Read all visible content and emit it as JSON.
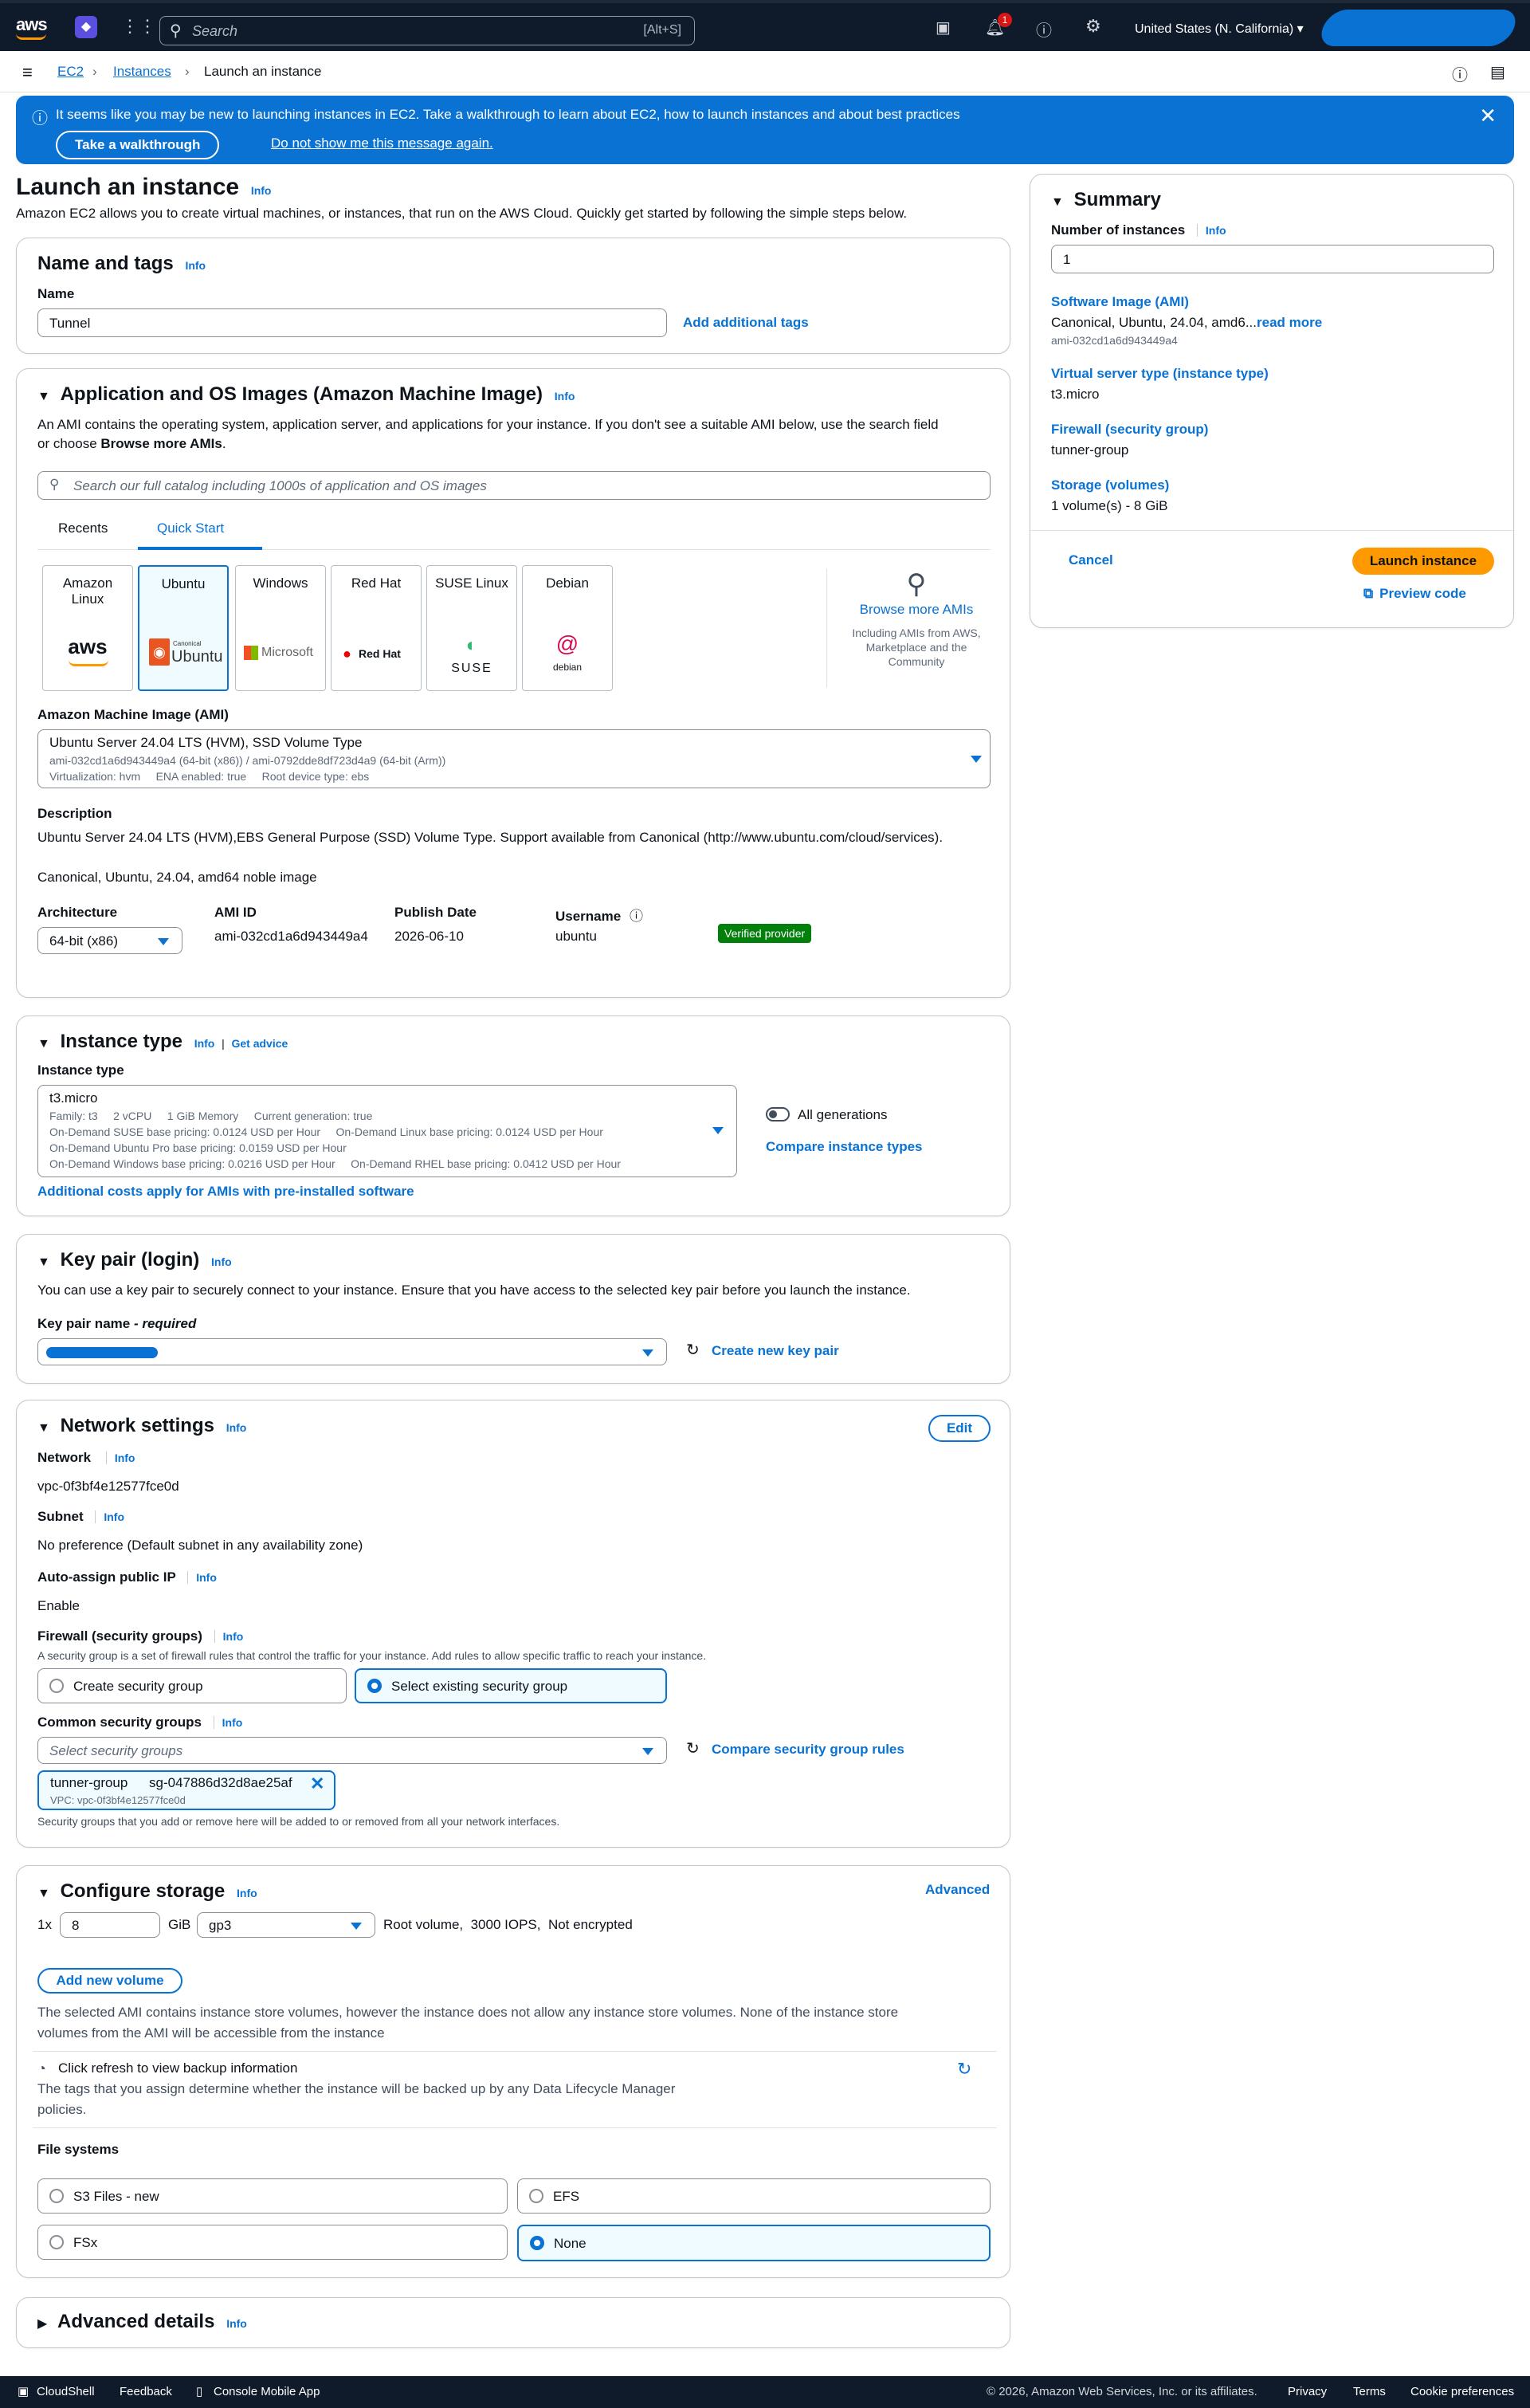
{
  "topnav": {
    "logo": "aws",
    "search_placeholder": "Search",
    "search_shortcut": "[Alt+S]",
    "notification_count": "1",
    "region": "United States (N. California)"
  },
  "breadcrumb": {
    "items": [
      "EC2",
      "Instances",
      "Launch an instance"
    ]
  },
  "flash": {
    "message": "It seems like you may be new to launching instances in EC2. Take a walkthrough to learn about EC2, how to launch instances and about best practices",
    "walkthrough_button": "Take a walkthrough",
    "dismiss_link": "Do not show me this message again."
  },
  "page": {
    "title": "Launch an instance",
    "info": "Info",
    "description": "Amazon EC2 allows you to create virtual machines, or instances, that run on the AWS Cloud. Quickly get started by following the simple steps below."
  },
  "name_tags": {
    "title": "Name and tags",
    "info": "Info",
    "name_label": "Name",
    "name_value": "Tunnel",
    "add_tags": "Add additional tags"
  },
  "ami": {
    "title": "Application and OS Images (Amazon Machine Image)",
    "info": "Info",
    "desc1": "An AMI contains the operating system, application server, and applications for your instance. If you don't see a suitable AMI below, use the search field",
    "desc2_pre": "or choose ",
    "desc2_bold": "Browse more AMIs",
    "desc2_post": ".",
    "search_placeholder": "Search our full catalog including 1000s of application and OS images",
    "tabs": [
      "Recents",
      "Quick Start"
    ],
    "tiles": [
      {
        "name": "Amazon Linux",
        "logo": "aws"
      },
      {
        "name": "Ubuntu",
        "logo": "Ubuntu"
      },
      {
        "name": "Windows",
        "logo": "Microsoft"
      },
      {
        "name": "Red Hat",
        "logo": "Red Hat"
      },
      {
        "name": "SUSE Linux",
        "logo": "SUSE"
      },
      {
        "name": "Debian",
        "logo": "debian"
      }
    ],
    "ubuntu_canonical": "Canonical",
    "browse_more": "Browse more AMIs",
    "browse_sub": "Including AMIs from AWS, Marketplace and the Community",
    "ami_label": "Amazon Machine Image (AMI)",
    "ami_name": "Ubuntu Server 24.04 LTS (HVM), SSD Volume Type",
    "ami_ids": "ami-032cd1a6d943449a4 (64-bit (x86)) / ami-0792dde8df723d4a9 (64-bit (Arm))",
    "ami_meta": "Virtualization: hvm     ENA enabled: true     Root device type: ebs",
    "description_label": "Description",
    "description_text": "Ubuntu Server 24.04 LTS (HVM),EBS General Purpose (SSD) Volume Type. Support available from Canonical (http://www.ubuntu.com/cloud/services).",
    "canonical_line": "Canonical, Ubuntu, 24.04, amd64 noble image",
    "arch_label": "Architecture",
    "arch_value": "64-bit (x86)",
    "amiid_label": "AMI ID",
    "amiid_value": "ami-032cd1a6d943449a4",
    "publish_label": "Publish Date",
    "publish_value": "2026-06-10",
    "username_label": "Username",
    "username_value": "ubuntu",
    "verified": "Verified provider"
  },
  "instance_type": {
    "title": "Instance type",
    "info": "Info",
    "sep": "|",
    "advice": "Get advice",
    "label": "Instance type",
    "value": "t3.micro",
    "line1": "Family: t3     2 vCPU     1 GiB Memory     Current generation: true",
    "line2": "On-Demand SUSE base pricing: 0.0124 USD per Hour     On-Demand Linux base pricing: 0.0124 USD per Hour",
    "line3": "On-Demand Ubuntu Pro base pricing: 0.0159 USD per Hour",
    "line4": "On-Demand Windows base pricing: 0.0216 USD per Hour     On-Demand RHEL base pricing: 0.0412 USD per Hour",
    "all_gen": "All generations",
    "compare": "Compare instance types",
    "additional": "Additional costs apply for AMIs with pre-installed software"
  },
  "key_pair": {
    "title": "Key pair (login)",
    "info": "Info",
    "desc": "You can use a key pair to securely connect to your instance. Ensure that you have access to the selected key pair before you launch the instance.",
    "label": "Key pair name",
    "required": " - required",
    "create": "Create new key pair"
  },
  "network": {
    "title": "Network settings",
    "info": "Info",
    "edit": "Edit",
    "network_label": "Network",
    "network_value": "vpc-0f3bf4e12577fce0d",
    "subnet_label": "Subnet",
    "subnet_value": "No preference (Default subnet in any availability zone)",
    "public_ip_label": "Auto-assign public IP",
    "public_ip_value": "Enable",
    "firewall_label": "Firewall (security groups)",
    "firewall_desc": "A security group is a set of firewall rules that control the traffic for your instance. Add rules to allow specific traffic to reach your instance.",
    "create_sg": "Create security group",
    "select_sg": "Select existing security group",
    "common_label": "Common security groups",
    "select_placeholder": "Select security groups",
    "compare_rules": "Compare security group rules",
    "token_name": "tunner-group",
    "token_id": "sg-047886d32d8ae25af",
    "token_vpc": "VPC: vpc-0f3bf4e12577fce0d",
    "note": "Security groups that you add or remove here will be added to or removed from all your network interfaces."
  },
  "storage": {
    "title": "Configure storage",
    "info": "Info",
    "advanced": "Advanced",
    "count": "1x",
    "size": "8",
    "unit": "GiB",
    "type": "gp3",
    "desc": "Root volume,  3000 IOPS,  Not encrypted",
    "add_volume": "Add new volume",
    "store_note1": "The selected AMI contains instance store volumes, however the instance does not allow any instance store volumes. None of the instance store",
    "store_note2": "volumes from the AMI will be accessible from the instance",
    "backup_title": "Click refresh to view backup information",
    "backup_desc1": "The tags that you assign determine whether the instance will be backed up by any Data Lifecycle Manager",
    "backup_desc2": "policies.",
    "fs_label": "File systems",
    "fs_options": [
      "S3 Files - new",
      "EFS",
      "FSx",
      "None"
    ]
  },
  "advanced": {
    "title": "Advanced details",
    "info": "Info"
  },
  "summary": {
    "title": "Summary",
    "num_label": "Number of instances",
    "info": "Info",
    "num_value": "1",
    "ami_label": "Software Image (AMI)",
    "ami_value": "Canonical, Ubuntu, 24.04, amd6...",
    "read_more": "read more",
    "ami_id": "ami-032cd1a6d943449a4",
    "type_label": "Virtual server type (instance type)",
    "type_value": "t3.micro",
    "fw_label": "Firewall (security group)",
    "fw_value": "tunner-group",
    "storage_label": "Storage (volumes)",
    "storage_value": "1 volume(s) - 8 GiB",
    "cancel": "Cancel",
    "launch": "Launch instance",
    "preview": "Preview code"
  },
  "footer": {
    "cloudshell": "CloudShell",
    "feedback": "Feedback",
    "mobile": "Console Mobile App",
    "copyright": "© 2026, Amazon Web Services, Inc. or its affiliates.",
    "privacy": "Privacy",
    "terms": "Terms",
    "cookies": "Cookie preferences"
  },
  "colors": {
    "accent": "#0972d3",
    "nav": "#0f1b2a",
    "launch": "#ff9900",
    "verified": "#037f0c"
  }
}
